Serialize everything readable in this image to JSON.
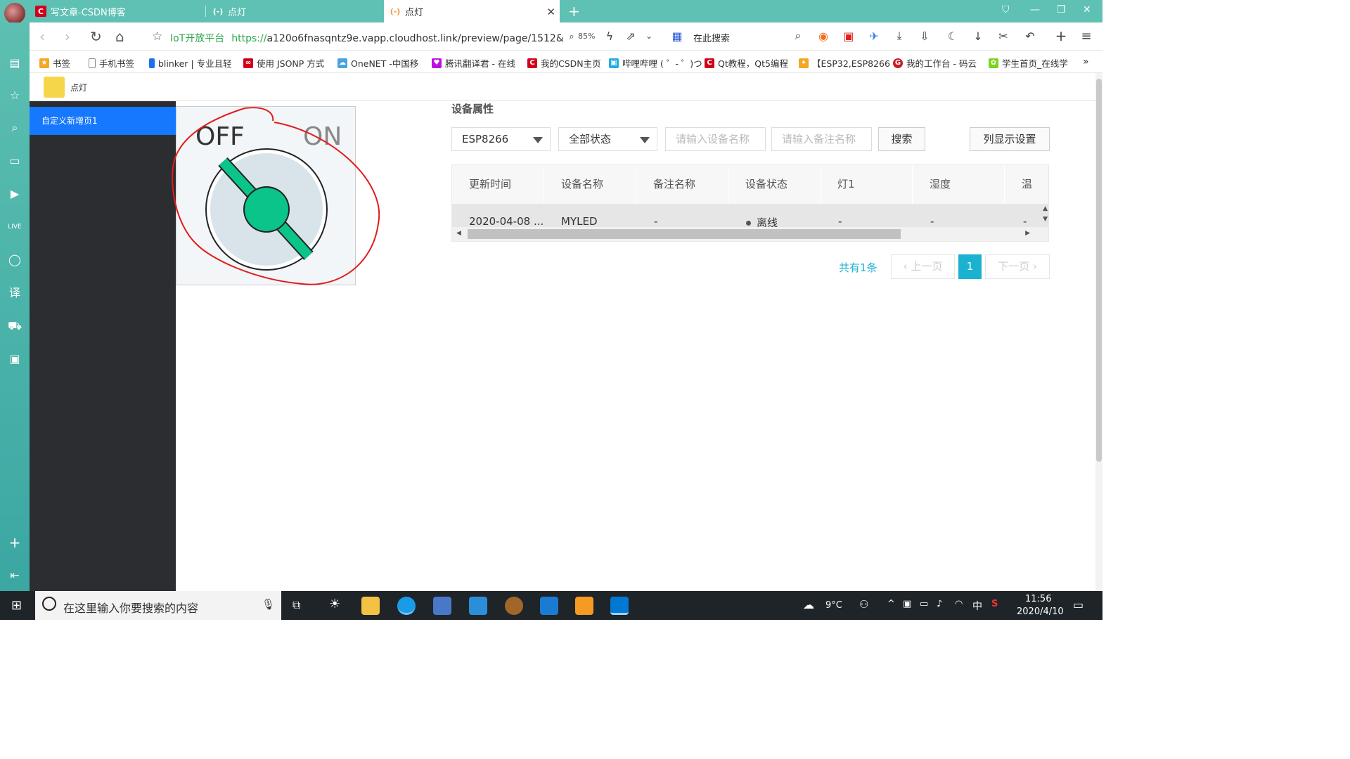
{
  "browser": {
    "tabs": [
      {
        "label": "写文章-CSDN博客",
        "icon": "C"
      },
      {
        "label": "点灯",
        "icon": "(-)"
      },
      {
        "label": "点灯",
        "icon": "(-)",
        "active": true
      }
    ],
    "new_tab": "+",
    "nav": {
      "back": "‹",
      "forward": "›",
      "reload": "↻",
      "home": "⌂",
      "star": "☆"
    },
    "address": {
      "site_name": "IoT开放平台",
      "protocol": "https://",
      "rest": "a120o6fnasqntz9e.vapp.cloudhost.link/preview/page/1512&"
    },
    "zoom": "85%",
    "search_placeholder": "在此搜索"
  },
  "bookmarks": [
    {
      "label": "书签",
      "icon_color": "#f5a623"
    },
    {
      "label": "手机书签",
      "icon_color": "#888888"
    },
    {
      "label": "blinker | 专业且轻",
      "icon_color": "#1a73e8"
    },
    {
      "label": "使用 JSONP 方式",
      "icon_color": "#d0021b"
    },
    {
      "label": "OneNET -中国移",
      "icon_color": "#4aa3df"
    },
    {
      "label": "腾讯翻译君 - 在线",
      "icon_color": "#bd10e0"
    },
    {
      "label": "我的CSDN主页",
      "icon_color": "#d0021b"
    },
    {
      "label": "哔哩哔哩 ( ゜- ゜)つ",
      "icon_color": "#23ade5"
    },
    {
      "label": "Qt教程，Qt5编程",
      "icon_color": "#d0021b"
    },
    {
      "label": "【ESP32,ESP8266",
      "icon_color": "#f5a623"
    },
    {
      "label": "我的工作台 - 码云",
      "icon_color": "#c71d23"
    },
    {
      "label": "学生首页_在线学",
      "icon_color": "#7ed321"
    }
  ],
  "page": {
    "title": "点灯",
    "nav_item": "自定义新增页1"
  },
  "switch": {
    "off_label": "OFF",
    "on_label": "ON",
    "state": "off",
    "accent": "#0bc48a"
  },
  "device_props": {
    "title": "设备属性",
    "product_select": "ESP8266",
    "status_select": "全部状态",
    "name_placeholder": "请输入设备名称",
    "remark_placeholder": "请输入备注名称",
    "search_button": "搜索",
    "columns_button": "列显示设置",
    "table": {
      "headers": [
        "更新时间",
        "设备名称",
        "备注名称",
        "设备状态",
        "灯1",
        "湿度",
        "温"
      ],
      "rows": [
        [
          "2020-04-08 ...",
          "MYLED",
          "-",
          "离线",
          "-",
          "-",
          "-"
        ]
      ]
    },
    "pagination": {
      "total": "共有1条",
      "prev": "上一页",
      "current": "1",
      "next": "下一页"
    }
  },
  "taskbar": {
    "search_placeholder": "在这里输入你要搜索的内容",
    "weather": "9°C",
    "ime": "中",
    "time": "11:56",
    "date": "2020/4/10"
  }
}
